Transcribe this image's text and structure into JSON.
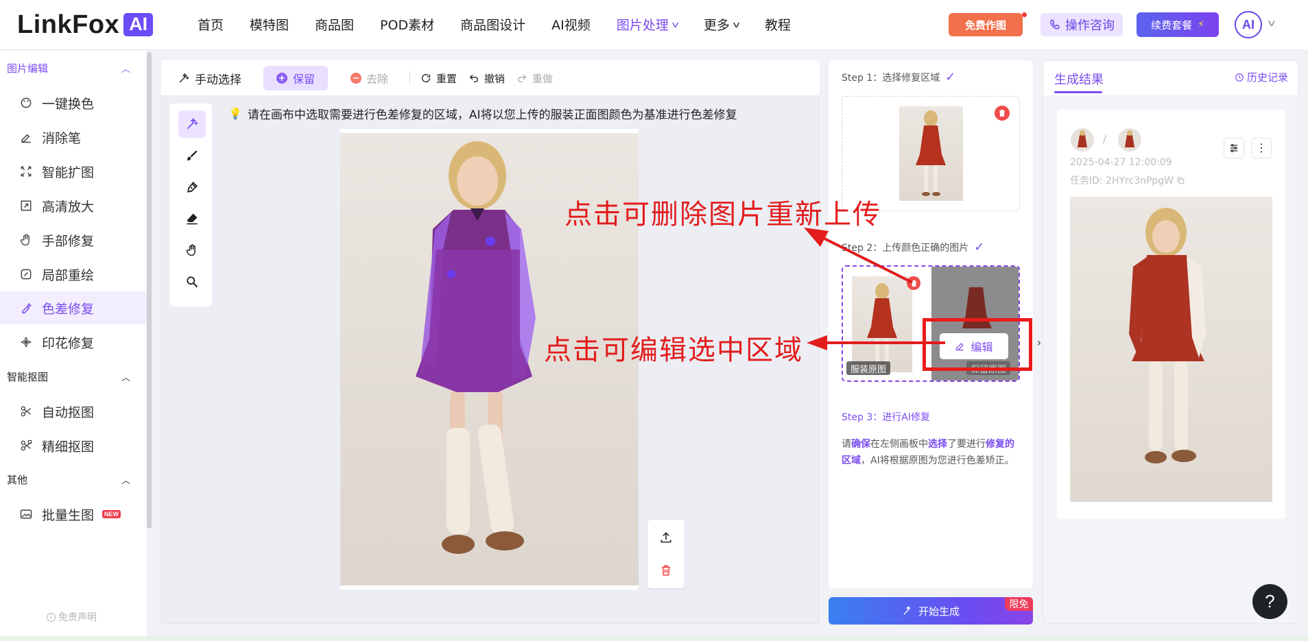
{
  "header": {
    "logo_text": "LinkFox",
    "logo_badge": "AI",
    "nav": [
      {
        "label": "首页",
        "active": false,
        "dropdown": false
      },
      {
        "label": "模特图",
        "active": false,
        "dropdown": false
      },
      {
        "label": "商品图",
        "active": false,
        "dropdown": false
      },
      {
        "label": "POD素材",
        "active": false,
        "dropdown": false
      },
      {
        "label": "商品图设计",
        "active": false,
        "dropdown": false
      },
      {
        "label": "AI视频",
        "active": false,
        "dropdown": false
      },
      {
        "label": "图片处理",
        "active": true,
        "dropdown": true
      },
      {
        "label": "更多",
        "active": false,
        "dropdown": true
      },
      {
        "label": "教程",
        "active": false,
        "dropdown": false
      }
    ],
    "free_btn": "免费作图",
    "consult_btn": "操作咨询",
    "renew_btn": "续费套餐",
    "avatar_text": "AI"
  },
  "sidebar": {
    "sections": [
      {
        "title": "图片编辑",
        "items": [
          {
            "label": "一键换色",
            "icon": "palette-icon"
          },
          {
            "label": "消除笔",
            "icon": "eraser-pen-icon"
          },
          {
            "label": "智能扩图",
            "icon": "expand-icon"
          },
          {
            "label": "高清放大",
            "icon": "upscale-icon"
          },
          {
            "label": "手部修复",
            "icon": "hand-icon"
          },
          {
            "label": "局部重绘",
            "icon": "redraw-icon"
          },
          {
            "label": "色差修复",
            "icon": "color-fix-icon",
            "active": true
          },
          {
            "label": "印花修复",
            "icon": "print-fix-icon"
          }
        ]
      },
      {
        "title": "智能抠图",
        "items": [
          {
            "label": "自动抠图",
            "icon": "auto-cutout-icon"
          },
          {
            "label": "精细抠图",
            "icon": "fine-cutout-icon"
          }
        ]
      },
      {
        "title": "其他",
        "items": [
          {
            "label": "批量生图",
            "icon": "image-batch-icon",
            "badge": "NEW"
          }
        ]
      }
    ],
    "disclaimer": "免责声明"
  },
  "toolbar": {
    "manual_select": "手动选择",
    "keep": "保留",
    "remove": "去除",
    "reset": "重置",
    "undo": "撤销",
    "redo": "重做"
  },
  "canvas": {
    "hint": "请在画布中选取需要进行色差修复的区域，AI将以您上传的服装正面图颜色为基准进行色差修复"
  },
  "steps": {
    "step1": "Step 1：选择修复区域",
    "step2": "Step 2：上传颜色正确的图片",
    "step3": "Step 3：进行AI修复",
    "step3_desc_parts": [
      "请",
      "确保",
      "在左侧画板中",
      "选择",
      "了要进行",
      "修复的区域",
      "，AI将根据原图为您进行色差矫正。"
    ],
    "label_original": "服装原图",
    "label_keep_region": "保留原图",
    "edit_btn": "编辑",
    "generate_btn": "开始生成",
    "generate_badge": "限免"
  },
  "result": {
    "tab": "生成结果",
    "history": "历史记录",
    "time": "2025-04-27 12:00:09",
    "task_id": "任务ID: 2HYrc3nPpgW",
    "slash": "/"
  },
  "annotations": {
    "delete_tip": "点击可删除图片重新上传",
    "edit_tip": "点击可编辑选中区域"
  },
  "colors": {
    "accent": "#7a4cf0",
    "annotation_red": "#e21c1c",
    "free_btn": "#f2704b"
  }
}
